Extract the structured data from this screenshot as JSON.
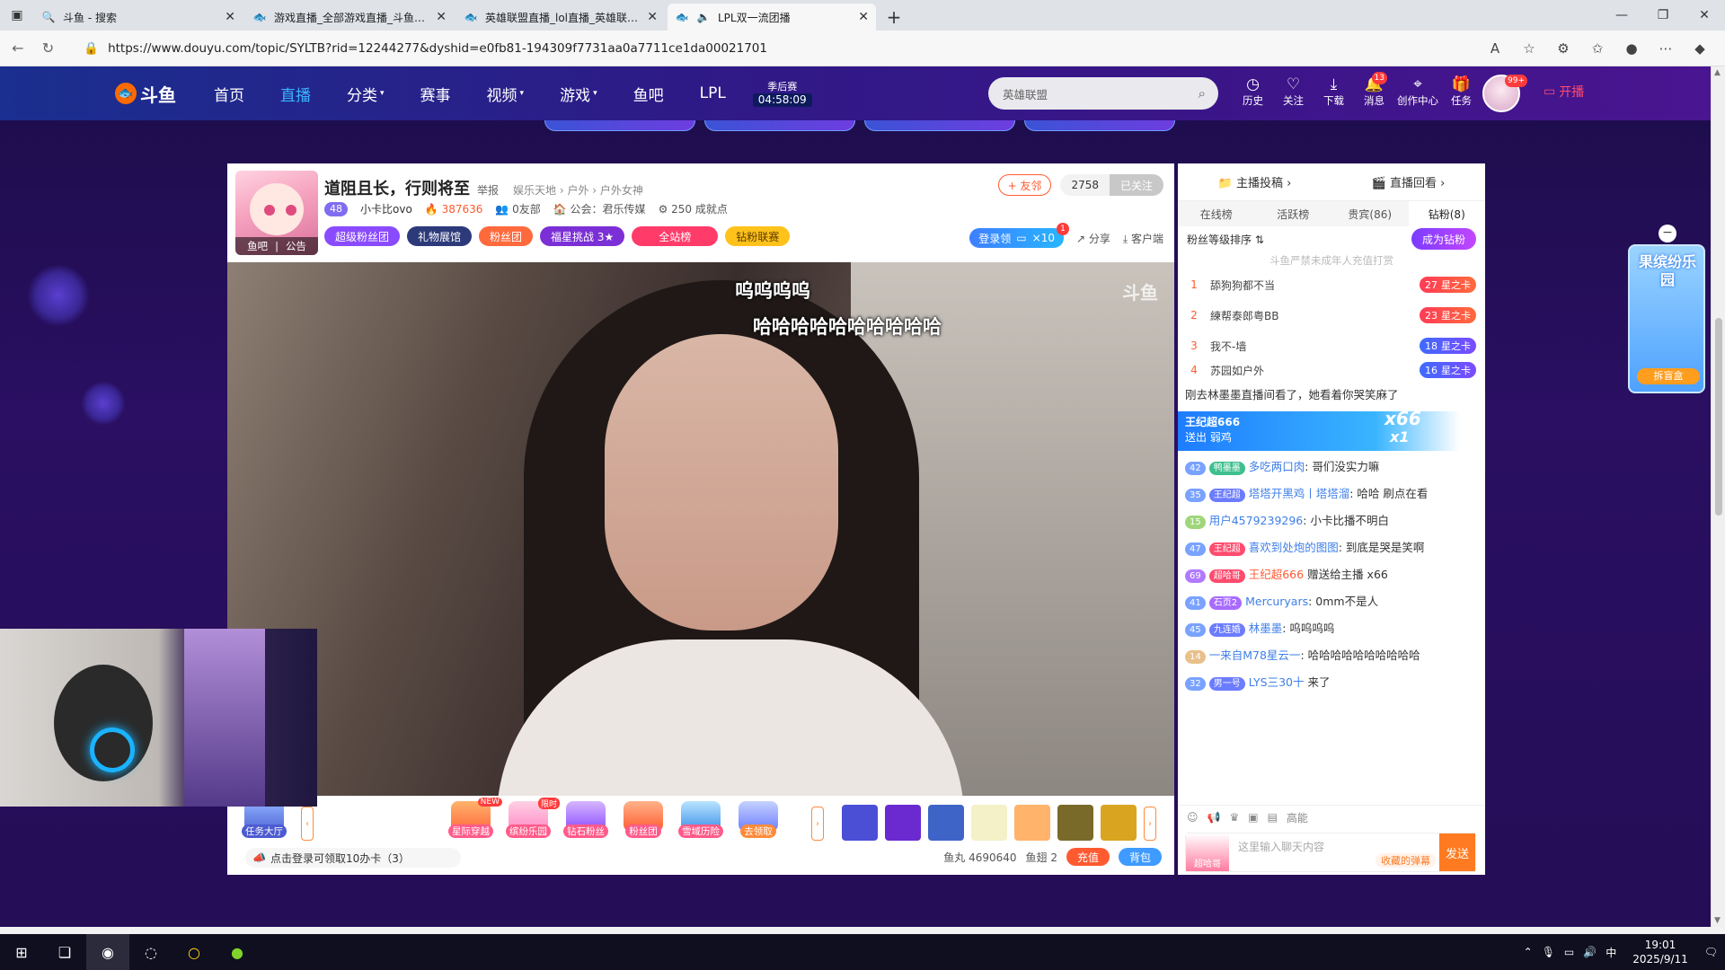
{
  "browser": {
    "tabs": [
      {
        "title": "斗鱼 - 搜索",
        "icon": "search-icon",
        "active": false
      },
      {
        "title": "游戏直播_全部游戏直播_斗鱼直播",
        "icon": "douyu-icon",
        "active": false
      },
      {
        "title": "英雄联盟直播_lol直播_英雄联盟直",
        "icon": "douyu-icon",
        "active": false
      },
      {
        "title": "LPL双一流团播",
        "icon": "douyu-icon",
        "active": true
      }
    ],
    "url": "https://www.douyu.com/topic/SYLTB?rid=12244277&dyshid=e0fb81-194309f7731aa0a7711ce1da00021701"
  },
  "header": {
    "logo": "斗鱼",
    "nav": [
      {
        "label": "首页",
        "caret": false,
        "active": false
      },
      {
        "label": "直播",
        "caret": false,
        "active": true
      },
      {
        "label": "分类",
        "caret": true,
        "active": false
      },
      {
        "label": "赛事",
        "caret": false,
        "active": false
      },
      {
        "label": "视频",
        "caret": true,
        "active": false
      },
      {
        "label": "游戏",
        "caret": true,
        "active": false
      },
      {
        "label": "鱼吧",
        "caret": false,
        "active": false
      },
      {
        "label": "LPL",
        "caret": false,
        "active": false
      }
    ],
    "season_label": "季后赛",
    "season_time": "04:58:09",
    "search_placeholder": "英雄联盟",
    "icons": [
      {
        "label": "历史",
        "icon": "history-icon",
        "badge": ""
      },
      {
        "label": "关注",
        "icon": "heart-icon",
        "badge": ""
      },
      {
        "label": "下载",
        "icon": "download-icon",
        "badge": ""
      },
      {
        "label": "消息",
        "icon": "bell-icon",
        "badge": "13"
      },
      {
        "label": "创作中心",
        "icon": "location-icon",
        "badge": ""
      },
      {
        "label": "任务",
        "icon": "gift-icon",
        "badge": ""
      }
    ],
    "avatar_badge": "99+",
    "broadcast_label": "开播"
  },
  "room": {
    "avatar_strip": [
      "鱼吧",
      "公告"
    ],
    "title": "道阻且长，行则将至",
    "report": "举报",
    "breadcrumb": "娱乐天地 › 户外 › 户外女神",
    "level": "48",
    "anchor": "小卡比ovo",
    "hot": "387636",
    "friends": "0友部",
    "guild": "公会：君乐传媒",
    "achievement": "250 成就点",
    "tags": [
      "超级粉丝团",
      "礼物展馆",
      "粉丝团",
      "福星挑战 3★",
      "全站榜",
      "钻粉联赛"
    ],
    "friend_btn": "+ 友邻",
    "fans_count": "2758",
    "followed": "已关注",
    "login_gift": "登录领",
    "login_gift_count": "×10",
    "login_gift_dot": "1",
    "share": "分享",
    "client": "客户端"
  },
  "video": {
    "danmaku": [
      "呜呜呜呜",
      "哈哈哈哈哈哈哈哈哈哈"
    ],
    "watermark": "斗鱼"
  },
  "toolbar": {
    "items": [
      {
        "label": "任务大厅",
        "flag": ""
      },
      {
        "label": "星际穿越",
        "flag": "NEW"
      },
      {
        "label": "缤纷乐园",
        "flag": "限时"
      },
      {
        "label": "钻石粉丝",
        "flag": ""
      },
      {
        "label": "粉丝团",
        "flag": ""
      },
      {
        "label": "雪域历险",
        "flag": ""
      },
      {
        "label": "去领取",
        "flag": ""
      }
    ],
    "claim": "点击登录可领取10办卡（3）",
    "fishball": "鱼丸 4690640",
    "fishfin": "鱼翅 2",
    "recharge": "充值",
    "backpack": "背包"
  },
  "side": {
    "top": [
      "主播投稿 ›",
      "直播回看 ›"
    ],
    "rank_tabs": [
      "在线榜",
      "活跃榜",
      "贵宾(86)",
      "钻粉(8)"
    ],
    "rank_sort": "粉丝等级排序 ⇅",
    "be_diamond": "成为钻粉",
    "rank_note": "斗鱼严禁未成年人充值打赏",
    "ranks": [
      {
        "no": "1",
        "name": "舔狗狗都不当",
        "lv": "27",
        "badge": "星之卡"
      },
      {
        "no": "2",
        "name": "練帮泰郎粤BB",
        "lv": "23",
        "badge": "星之卡"
      },
      {
        "no": "3",
        "name": "我不-墙",
        "lv": "18",
        "badge": "星之卡"
      },
      {
        "no": "4",
        "name": "苏园如户外",
        "lv": "16",
        "badge": "星之卡"
      }
    ],
    "chat_top": "刚去林墨墨直播间看了，她看着你哭笑麻了",
    "gift_banner_user": "王纪超666",
    "gift_banner_action": "送出  弱鸡",
    "gift_banner_count": "x66",
    "gift_banner_count2": "x1",
    "chat": [
      {
        "lv": "42",
        "fan": "鸭墨墨",
        "nick": "多吃两口肉",
        "text": ": 哥们没实力嘛"
      },
      {
        "lv": "35",
        "fan": "王纪超",
        "nick": "塔塔开黑鸡丨塔塔溜",
        "text": ": 哈哈  刷点在看"
      },
      {
        "lv": "15",
        "fan": "",
        "nick": "用户4579239296",
        "text": ": 小卡比播不明白"
      },
      {
        "lv": "47",
        "fan": "王纪超",
        "nick": "喜欢到处炮的图图",
        "text": ": 到底是哭是笑啊"
      },
      {
        "lv": "69",
        "fan": "超哈哥",
        "nick": "王纪超666",
        "text": " 赠送给主播 x66"
      },
      {
        "lv": "41",
        "fan": "石页2",
        "nick": "Mercuryars",
        "text": ": 0mm不是人"
      },
      {
        "lv": "45",
        "fan": "九连婚",
        "nick": "林墨墨",
        "text": ": 呜呜呜呜"
      },
      {
        "lv": "14",
        "fan": "",
        "nick": "一来自M78星云一",
        "text": ": 哈哈哈哈哈哈哈哈哈哈"
      },
      {
        "lv": "32",
        "fan": "男一号",
        "nick": "LYS三30十",
        "text": " 来了"
      }
    ],
    "chat_tool_text": "高能",
    "input_placeholder": "这里输入聊天内容",
    "barrage": "收藏的弹幕",
    "send": "发送",
    "input_badge": "超哈哥"
  },
  "float_ad": {
    "title": "果缤纷乐园",
    "button": "拆盲盒"
  },
  "taskbar": {
    "time": "19:01",
    "date": "2025/9/11",
    "ime": "中"
  },
  "colors": {
    "accent": "#3ab3ff",
    "douyu_orange": "#ff5a30",
    "page_bg": "#23104f"
  }
}
